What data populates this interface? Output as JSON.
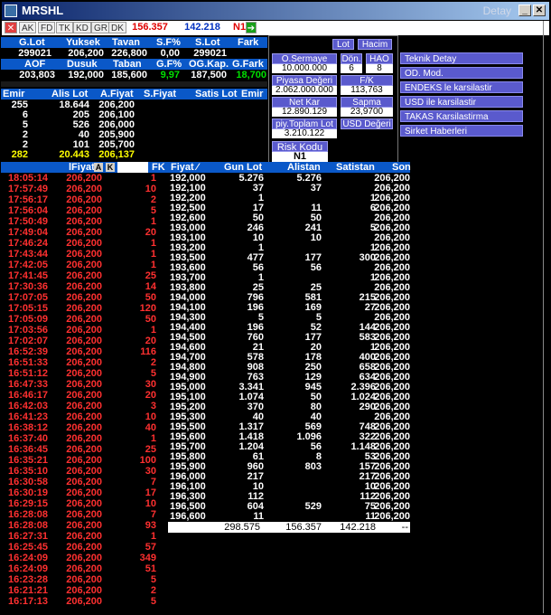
{
  "window": {
    "title": "MRSHL",
    "title_right": "Detay"
  },
  "toolbar": {
    "tabs": [
      "AK",
      "FD",
      "TK",
      "KD",
      "GR",
      "DK"
    ],
    "value_red": "156.357",
    "value_blue": "142.218",
    "badge": "N1"
  },
  "summary1": {
    "headers": [
      "G.Lot",
      "Yuksek",
      "Tavan",
      "S.F%",
      "S.Lot",
      "Fark"
    ],
    "values": [
      "299021",
      "206,200",
      "226,800",
      "0,00",
      "299021",
      ""
    ]
  },
  "summary2": {
    "headers": [
      "AOF",
      "Dusuk",
      "Taban",
      "G.F%",
      "OG.Kap.",
      "G.Fark"
    ],
    "values": [
      "203,803",
      "192,000",
      "185,600",
      "9,97",
      "187,500",
      "18,700"
    ]
  },
  "depth": {
    "headers": [
      "Emir",
      "Alis Lot",
      "A.Fiyat",
      "S.Fiyat",
      "Satis Lot",
      "Emir"
    ],
    "rows": [
      [
        "255",
        "18.644",
        "206,200"
      ],
      [
        "6",
        "205",
        "206,100"
      ],
      [
        "5",
        "526",
        "206,000"
      ],
      [
        "2",
        "40",
        "205,900"
      ],
      [
        "2",
        "101",
        "205,700"
      ],
      [
        "282",
        "20.443",
        "206,137"
      ]
    ]
  },
  "info": {
    "lot_label": "Lot",
    "hacim_label": "Hacim",
    "o_sermaye_label": "O.Sermaye",
    "o_sermaye_value": "10.000.000",
    "don_label": "Dön.",
    "don_value": "6",
    "hao_label": "HAO",
    "hao_value": "8",
    "piyasa_label": "Piyasa Değeri",
    "piyasa_value": "2.062.000.000",
    "fk_label": "F/K",
    "fk_value": "113,763",
    "netkar_label": "Net Kar",
    "netkar_value": "12.890.129",
    "sapma_label": "Sapma",
    "sapma_value": "23,9700",
    "piytoplam_label": "piy.Toplam Lot",
    "piytoplam_value": "3.210.122",
    "usd_label": "USD Değeri",
    "risk_label": "Risk Kodu",
    "risk_value": "N1"
  },
  "menu": [
    "Teknik Detay",
    "OD. Mod.",
    "ENDEKS le karsilastir",
    "USD ile karsilastir",
    "TAKAS Karsilastirma",
    "Sirket Haberleri"
  ],
  "trades": {
    "headers": [
      "lFiyat",
      "A",
      "K",
      "FK"
    ],
    "rows": [
      [
        "18:05:14",
        "206,200",
        "1"
      ],
      [
        "17:57:49",
        "206,200",
        "10"
      ],
      [
        "17:56:17",
        "206,200",
        "2"
      ],
      [
        "17:56:04",
        "206,200",
        "5"
      ],
      [
        "17:50:49",
        "206,200",
        "1"
      ],
      [
        "17:49:04",
        "206,200",
        "20"
      ],
      [
        "17:46:24",
        "206,200",
        "1"
      ],
      [
        "17:43:44",
        "206,200",
        "1"
      ],
      [
        "17:42:05",
        "206,200",
        "1"
      ],
      [
        "17:41:45",
        "206,200",
        "25"
      ],
      [
        "17:30:36",
        "206,200",
        "14"
      ],
      [
        "17:07:05",
        "206,200",
        "50"
      ],
      [
        "17:05:15",
        "206,200",
        "120"
      ],
      [
        "17:05:09",
        "206,200",
        "50"
      ],
      [
        "17:03:56",
        "206,200",
        "1"
      ],
      [
        "17:02:07",
        "206,200",
        "20"
      ],
      [
        "16:52:39",
        "206,200",
        "116"
      ],
      [
        "16:51:33",
        "206,200",
        "2"
      ],
      [
        "16:51:12",
        "206,200",
        "5"
      ],
      [
        "16:47:33",
        "206,200",
        "30"
      ],
      [
        "16:46:17",
        "206,200",
        "20"
      ],
      [
        "16:42:03",
        "206,200",
        "3"
      ],
      [
        "16:41:23",
        "206,200",
        "10"
      ],
      [
        "16:38:12",
        "206,200",
        "40"
      ],
      [
        "16:37:40",
        "206,200",
        "1"
      ],
      [
        "16:36:45",
        "206,200",
        "25"
      ],
      [
        "16:35:21",
        "206,200",
        "100"
      ],
      [
        "16:35:10",
        "206,200",
        "30"
      ],
      [
        "16:30:58",
        "206,200",
        "7"
      ],
      [
        "16:30:19",
        "206,200",
        "17"
      ],
      [
        "16:29:15",
        "206,200",
        "10"
      ],
      [
        "16:28:08",
        "206,200",
        "7"
      ],
      [
        "16:28:08",
        "206,200",
        "93"
      ],
      [
        "16:27:31",
        "206,200",
        "1"
      ],
      [
        "16:25:45",
        "206,200",
        "57"
      ],
      [
        "16:24:09",
        "206,200",
        "349"
      ],
      [
        "16:24:09",
        "206,200",
        "51"
      ],
      [
        "16:23:28",
        "206,200",
        "5"
      ],
      [
        "16:21:21",
        "206,200",
        "2"
      ],
      [
        "16:17:13",
        "206,200",
        "5"
      ]
    ]
  },
  "distribution": {
    "headers": [
      "Fiyat",
      "Gun Lot",
      "Alistan",
      "Satistan",
      "Son"
    ],
    "rows": [
      [
        "192,000",
        "5.276",
        "5.276",
        "",
        "206,200"
      ],
      [
        "192,100",
        "37",
        "37",
        "",
        "206,200"
      ],
      [
        "192,200",
        "1",
        "",
        "1",
        "206,200"
      ],
      [
        "192,500",
        "17",
        "11",
        "6",
        "206,200"
      ],
      [
        "192,600",
        "50",
        "50",
        "",
        "206,200"
      ],
      [
        "193,000",
        "246",
        "241",
        "5",
        "206,200"
      ],
      [
        "193,100",
        "10",
        "10",
        "",
        "206,200"
      ],
      [
        "193,200",
        "1",
        "",
        "1",
        "206,200"
      ],
      [
        "193,500",
        "477",
        "177",
        "300",
        "206,200"
      ],
      [
        "193,600",
        "56",
        "56",
        "",
        "206,200"
      ],
      [
        "193,700",
        "1",
        "",
        "1",
        "206,200"
      ],
      [
        "193,800",
        "25",
        "25",
        "",
        "206,200"
      ],
      [
        "194,000",
        "796",
        "581",
        "215",
        "206,200"
      ],
      [
        "194,100",
        "196",
        "169",
        "27",
        "206,200"
      ],
      [
        "194,300",
        "5",
        "5",
        "",
        "206,200"
      ],
      [
        "194,400",
        "196",
        "52",
        "144",
        "206,200"
      ],
      [
        "194,500",
        "760",
        "177",
        "583",
        "206,200"
      ],
      [
        "194,600",
        "21",
        "20",
        "1",
        "206,200"
      ],
      [
        "194,700",
        "578",
        "178",
        "400",
        "206,200"
      ],
      [
        "194,800",
        "908",
        "250",
        "658",
        "206,200"
      ],
      [
        "194,900",
        "763",
        "129",
        "634",
        "206,200"
      ],
      [
        "195,000",
        "3.341",
        "945",
        "2.396",
        "206,200"
      ],
      [
        "195,100",
        "1.074",
        "50",
        "1.024",
        "206,200"
      ],
      [
        "195,200",
        "370",
        "80",
        "290",
        "206,200"
      ],
      [
        "195,300",
        "40",
        "40",
        "",
        "206,200"
      ],
      [
        "195,500",
        "1.317",
        "569",
        "748",
        "206,200"
      ],
      [
        "195,600",
        "1.418",
        "1.096",
        "322",
        "206,200"
      ],
      [
        "195,700",
        "1.204",
        "56",
        "1.148",
        "206,200"
      ],
      [
        "195,800",
        "61",
        "8",
        "53",
        "206,200"
      ],
      [
        "195,900",
        "960",
        "803",
        "157",
        "206,200"
      ],
      [
        "196,000",
        "217",
        "",
        "217",
        "206,200"
      ],
      [
        "196,100",
        "10",
        "",
        "10",
        "206,200"
      ],
      [
        "196,300",
        "112",
        "",
        "112",
        "206,200"
      ],
      [
        "196,500",
        "604",
        "529",
        "75",
        "206,200"
      ],
      [
        "196,600",
        "11",
        "",
        "11",
        "206,200"
      ]
    ],
    "totals": [
      "298.575",
      "156.357",
      "142.218",
      "--"
    ]
  },
  "colors": {
    "header_bg": "#0a58c8",
    "trade_red": "#ff3030",
    "accent_yellow": "#ffff00",
    "green": "#00e000",
    "button_purple": "#5a5acd"
  }
}
